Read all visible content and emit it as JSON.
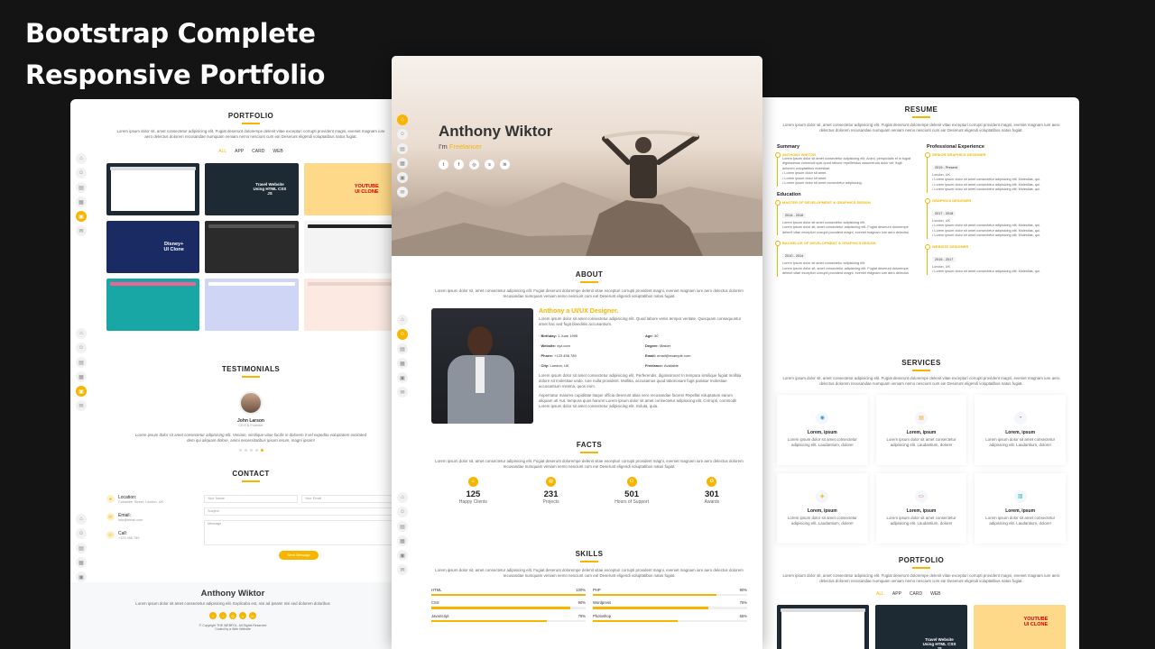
{
  "headline": {
    "line1": "Bootstrap Complete",
    "line2": "Responsive Portfolio"
  },
  "lorem_intro": "Lorem ipsum dolor sit, amet consectetur adipisicing elit. Fugiat deserunt dolorempe delenit vitae excepturi corrupti provident magni, eveniet magnam iure aero delectus dolorem recusandae numquam veniam nemo nesciunt cum ea! Deserunt eligendi voluptatibus natus fugiat.",
  "portfolio": {
    "title": "PORTFOLIO",
    "filters": [
      "ALL",
      "APP",
      "CARD",
      "WEB"
    ],
    "thumbs": [
      {
        "text": "",
        "color": "#ffffff"
      },
      {
        "text": "",
        "color": "#1d2a34"
      },
      {
        "text": "YOUTUBE UI CLONE",
        "color": "#ffd98a"
      },
      {
        "text": "Disney+ UI Clone",
        "color": "#1a2b63"
      },
      {
        "text": "",
        "color": "#2b2b2b"
      },
      {
        "text": "",
        "color": "#f4f4f4"
      },
      {
        "text": "",
        "color": "#19a7a5"
      },
      {
        "text": "",
        "color": "#cfd5f5"
      },
      {
        "text": "",
        "color": "#fbe9e2"
      }
    ],
    "thumb_extra": "Travel Website Using HTML CSS JS"
  },
  "testimonials": {
    "title": "TESTIMONIALS",
    "name": "John Larson",
    "role": "CEO & Founder",
    "quote": "Lorem ipsum dolor sit amet consectetur adipisicing elit. Veniam, similique vitae facilis in dolorem it vel expedita voluptatem excitated dem qui aliquam dolore, animi necessitatibus ipsum rerum, magni ipsam!"
  },
  "contact": {
    "title": "CONTACT",
    "items": [
      {
        "label": "Location:",
        "value": "Coriander Street, London, UK"
      },
      {
        "label": "Email:",
        "value": "info@email.com"
      },
      {
        "label": "Call:",
        "value": "+123 456 789"
      }
    ],
    "fields": {
      "name": "Your Name",
      "email": "Your Email",
      "subject": "Subject",
      "message": "Message"
    },
    "send": "Send Message"
  },
  "footer": {
    "name": "Anthony Wiktor",
    "text": "Lorem ipsum dolor sit amet consectetur adipisicing elit. Explicabo est, nisi ad ipsam! nisi sed dolorem doloribus",
    "copyright": "© Copyright THE WEBFOL. All Rights Reserved",
    "credit": "Coded by a Web Website"
  },
  "hero": {
    "name": "Anthony Wiktor",
    "prefix": "I'm ",
    "typed": "Freelancer"
  },
  "about": {
    "title": "ABOUT",
    "headline": "Anthony a UI/UX Designer.",
    "lead": "Lorem ipsum dolor sit amet consectetur adipisicing elit. Quod labore venis tempor veritate. Quisquam consequuntur amet hac sed fugit blanditiis accusantium.",
    "fields": [
      {
        "k": "Birthday:",
        "v": "1 June 1995"
      },
      {
        "k": "Age:",
        "v": "30"
      },
      {
        "k": "Website:",
        "v": "xyz.com"
      },
      {
        "k": "Degree:",
        "v": "Master"
      },
      {
        "k": "Phone:",
        "v": "+123 456 789"
      },
      {
        "k": "Email:",
        "v": "email@example.com"
      },
      {
        "k": "City:",
        "v": "London, UK"
      },
      {
        "k": "Freelance:",
        "v": "Available"
      }
    ],
    "para1": "Lorem ipsum dolor sit amet consectetur adipisicing elit. Perferendis, dignissimos! In tempora similique fugiat mollitia dolore sit molestiae unde. Iure nulla provident. Mollitia, accusamus quod laboriosam fugit pariatur molestiae accusantium minima, quos eum.",
    "para2": "Aspernatur maiores cupiditate itaque officia deserunt alias vero recusandae facere! Repellat voluptatum earum aliquam ut! Aut, tempora quos harum! Lorem ipsum dolor sit amet consectetur adipisicing elit. Corrupti, commodi! Lorem ipsum dolor sit amet consectetur adipisicing elit. Soluta, quia."
  },
  "facts": {
    "title": "FACTS",
    "items": [
      {
        "num": "125",
        "label": "Happy Clients"
      },
      {
        "num": "231",
        "label": "Projects"
      },
      {
        "num": "501",
        "label": "Hours of Support"
      },
      {
        "num": "301",
        "label": "Awards"
      }
    ]
  },
  "skills": {
    "title": "SKILLS",
    "items": [
      {
        "name": "HTML",
        "pct": "100%",
        "val": 100
      },
      {
        "name": "PHP",
        "pct": "80%",
        "val": 80
      },
      {
        "name": "CSS",
        "pct": "90%",
        "val": 90
      },
      {
        "name": "Wordpress",
        "pct": "75%",
        "val": 75
      },
      {
        "name": "JavaScript",
        "pct": "75%",
        "val": 75
      },
      {
        "name": "Photoshop",
        "pct": "55%",
        "val": 55
      }
    ]
  },
  "resume": {
    "title": "RESUME",
    "summary_title": "Summary",
    "summary_name": "ANTHONY WIKTOR",
    "summary_text": "Lorem ipsum dolor sit amet consectetur adipisicing elit. Animi, perspiciatis et in fugiat dignissimos commodi quis quod ratione repellendus assumenda dolor vel, fugit dolorem voluptatibus molestiae.",
    "summary_list": [
      "Lorem ipsum dolor sit amet.",
      "Lorem ipsum dolor sit amet.",
      "Lorem ipsum dolor sit amet consectetur adipisicing."
    ],
    "education_title": "Education",
    "education": [
      {
        "head": "MASTER OF DEVELOPMENT & GRAPHICS DESIGN",
        "date": "2014 - 2016",
        "text": "Lorem ipsum dolor sit amet consectetur adipisicing elit."
      },
      {
        "head": "BACHELOR OF DEVELOPMENT & GRAPHICS DESIGN",
        "date": "2010 - 2014",
        "text": "Lorem ipsum dolor sit amet consectetur adipisicing elit."
      }
    ],
    "experience_title": "Professional Experience",
    "experience": [
      {
        "head": "SENIOR GRAPHICS DESIGNER",
        "date": "2019 - Present",
        "loc": "London, UK"
      },
      {
        "head": "GRAPHICS DESIGNER",
        "date": "2017 - 2018",
        "loc": "London, UK"
      },
      {
        "head": "WEBSITE DESIGNER",
        "date": "2016 - 2017",
        "loc": "London, UK"
      }
    ],
    "exp_bullet": "Lorem ipsum dolor sit amet consectetur adipisicing elit. Molestias, qui."
  },
  "services": {
    "title": "SERVICES",
    "items": [
      {
        "title": "Lorem, ipsum",
        "icon": "◉",
        "color": "#4a90e2"
      },
      {
        "title": "Lorem, ipsum",
        "icon": "▤",
        "color": "#f5a623"
      },
      {
        "title": "Lorem, ipsum",
        "icon": "◔",
        "color": "#e5396a"
      },
      {
        "title": "Lorem, ipsum",
        "icon": "◈",
        "color": "#f7b500"
      },
      {
        "title": "Lorem, ipsum",
        "icon": "▭",
        "color": "#e9573f"
      },
      {
        "title": "Lorem, ipsum",
        "icon": "▥",
        "color": "#2bb5b8"
      }
    ],
    "text": "Lorem ipsum dolor sit amet consectetur adipisicing elit. Laudantium, dolore!"
  },
  "colors": {
    "accent": "#f7b500",
    "background": "#141414"
  }
}
